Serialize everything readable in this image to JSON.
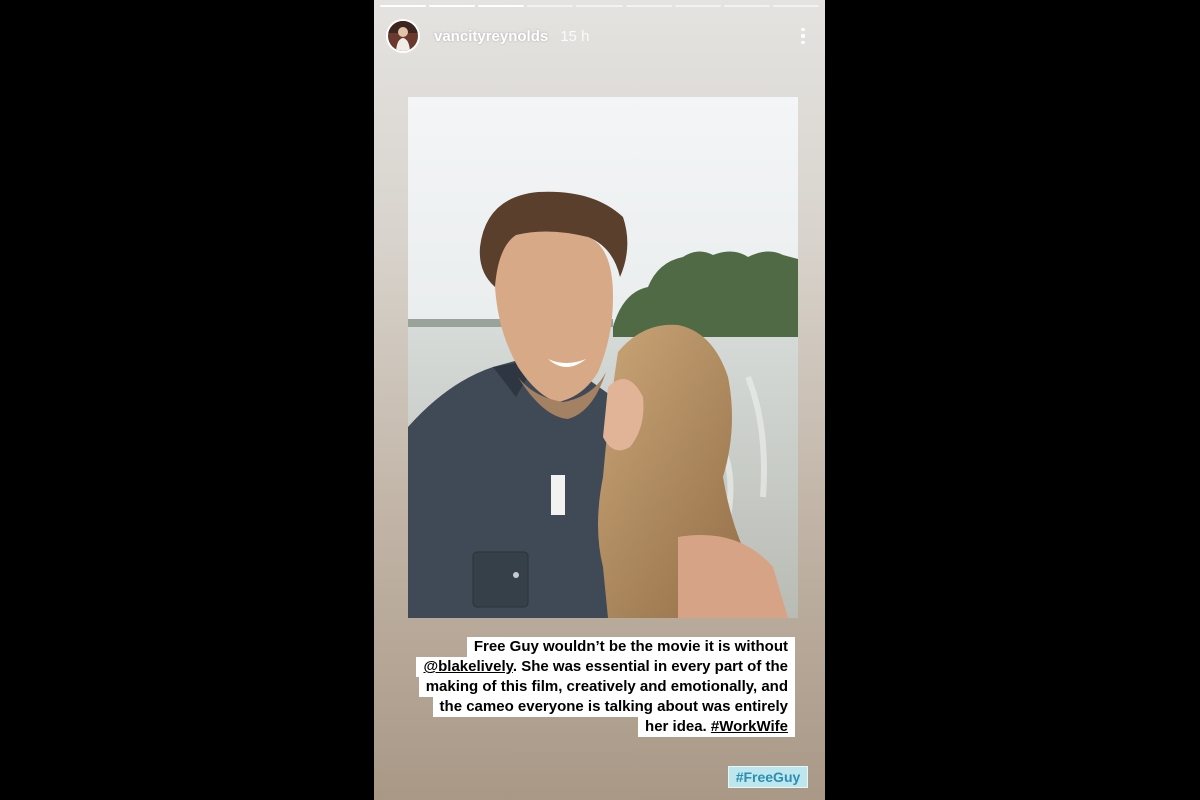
{
  "story": {
    "username": "vancityreynolds",
    "time_ago": "15 h",
    "progress": {
      "segments": 9,
      "current_index": 2
    },
    "caption": {
      "line1": "Free Guy wouldn’t be the movie it is without",
      "line2_mention": "@blakelively",
      "line2_rest": ". She was essential in every part of the",
      "line3": "making of this film, creatively and emotionally, and",
      "line4": "the cameo everyone is talking about was entirely",
      "line5_pre": "her idea. ",
      "line5_hashtag": "#WorkWife"
    },
    "hashtag_sticker": "#FreeGuy",
    "icons": {
      "menu": "more-vertical-icon",
      "avatar": "profile-avatar"
    },
    "colors": {
      "gradient_top": "#e4e3e1",
      "gradient_bottom": "#a99886",
      "sticker_bg": "#bde6ef",
      "sticker_text": "#2b8fb1"
    }
  }
}
